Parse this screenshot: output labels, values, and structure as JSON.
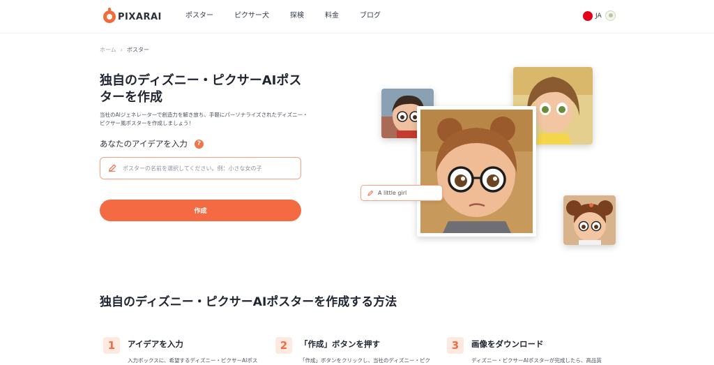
{
  "brand": {
    "name": "PIXARAI"
  },
  "nav": {
    "items": [
      "ポスター",
      "ピクサー犬",
      "探検",
      "料金",
      "ブログ"
    ]
  },
  "language": {
    "code": "JA"
  },
  "breadcrumb": {
    "home": "ホーム",
    "separator": "›",
    "current": "ポスター"
  },
  "hero": {
    "title": "独自のディズニー・ピクサーAIポスターを作成",
    "description": "当社のAIジェネレーターで創造力を解き放ち、手軽にパーソナライズされたディズニー・ピクサー風ポスターを作成しましょう！",
    "idea_label": "あなたのアイデアを入力",
    "help_icon": "?",
    "input_placeholder": "ポスターの名前を選択してください。例：小さな女の子",
    "input_value": "",
    "create_button": "作成",
    "prompt_chip": "A little girl"
  },
  "how_to": {
    "title": "独自のディズニー・ピクサーAIポスターを作成する方法",
    "steps": [
      {
        "num": "1",
        "title": "アイデアを入力",
        "desc": "入力ボックスに、希望するディズニー・ピクサーAIポス"
      },
      {
        "num": "2",
        "title": "「作成」ボタンを押す",
        "desc": "「作成」ボタンをクリックし、当社のディズニー・ピク"
      },
      {
        "num": "3",
        "title": "画像をダウンロード",
        "desc": "ディズニー・ピクサーAIポスターが完成したら、高品質"
      }
    ]
  },
  "colors": {
    "accent": "#f46a43",
    "accent_light": "#fde9e0",
    "input_border": "#f4a283"
  },
  "icons": [
    "logo-icon",
    "flag-icon",
    "user-icon",
    "pencil-icon",
    "help-icon"
  ]
}
